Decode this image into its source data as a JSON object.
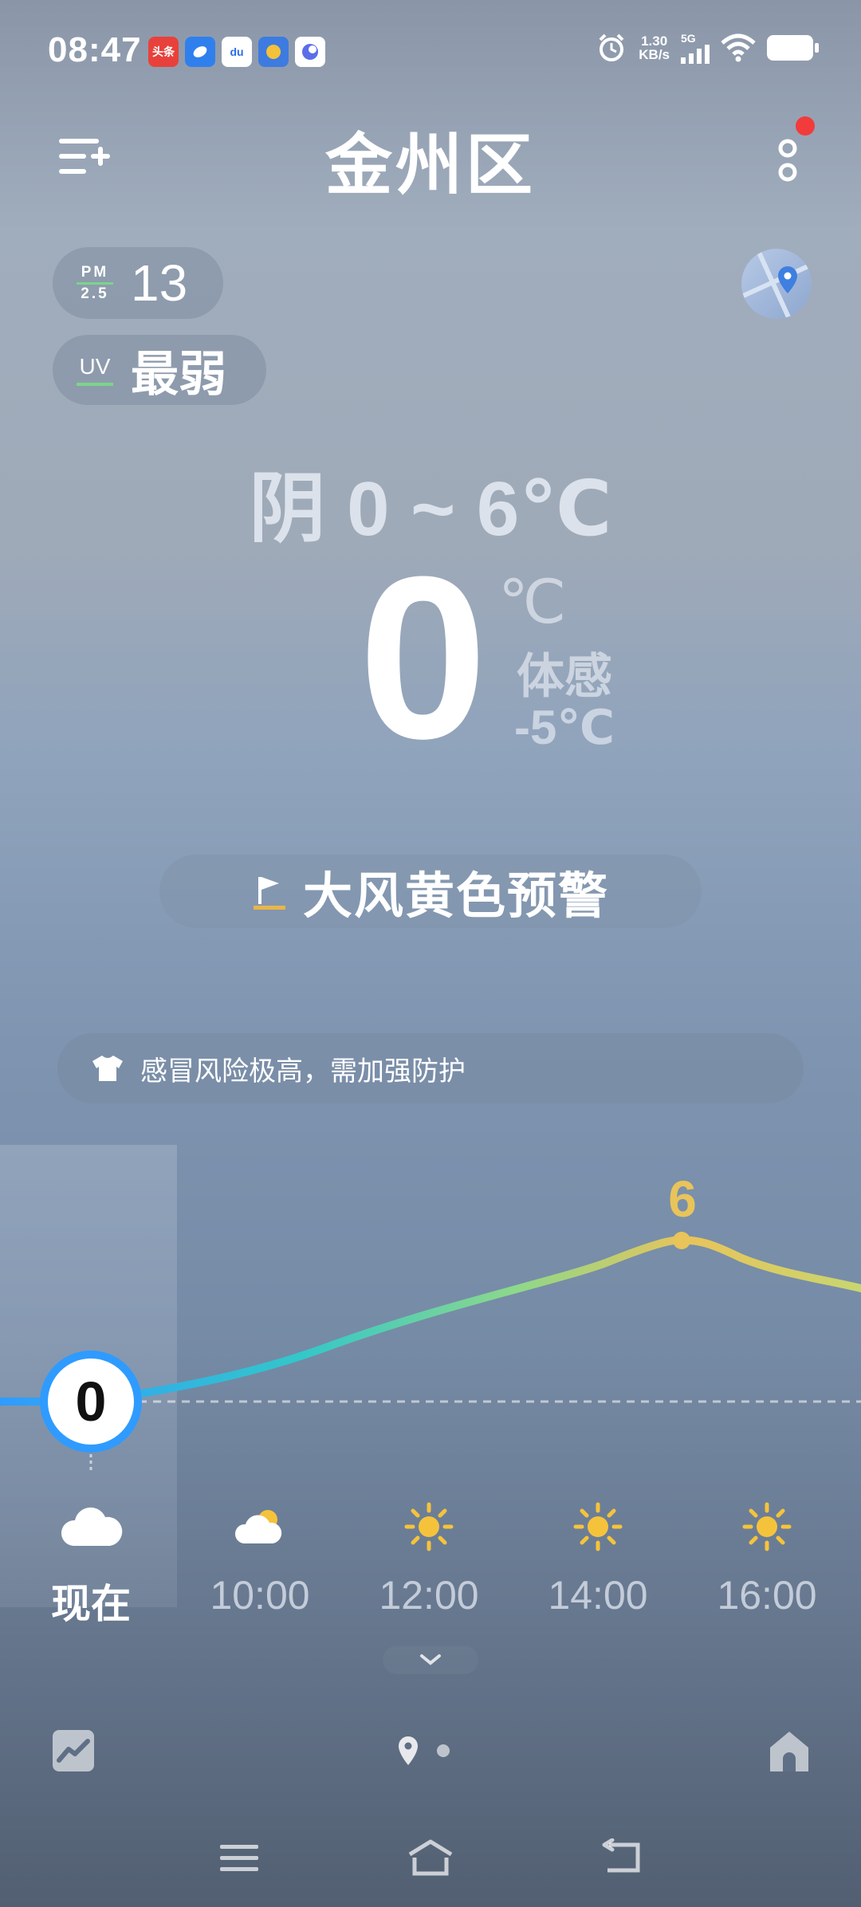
{
  "status_bar": {
    "time": "08:47",
    "notifications": [
      {
        "name": "toutiao-notification-icon",
        "text": "头条",
        "color": "#e8413b"
      },
      {
        "name": "chat-notification-icon",
        "text": "",
        "color": "#2f80ed"
      },
      {
        "name": "baidu-notification-icon",
        "text": "du",
        "color": "#2b6de8"
      },
      {
        "name": "app-notification-icon",
        "text": "",
        "color": "#3d7be0"
      },
      {
        "name": "browser-notification-icon",
        "text": "",
        "color": "#5b6ee8"
      }
    ],
    "net_speed_value": "1.30",
    "net_speed_unit": "KB/s",
    "network_type": "5G"
  },
  "header": {
    "city": "金州区"
  },
  "air": {
    "pm_label_top": "PM",
    "pm_label_bottom": "2.5",
    "pm_value": "13",
    "uv_label": "UV",
    "uv_value": "最弱"
  },
  "current": {
    "range_text": "阴 0 ~ 6℃",
    "temperature": "0",
    "unit": "℃",
    "feels_label": "体感",
    "feels_value": "-5℃"
  },
  "alert": {
    "text": "大风黄色预警",
    "color": "#e8b54a"
  },
  "advice": {
    "text": "感冒风险极高，需加强防护"
  },
  "hourly": {
    "current_temp": "0",
    "peak_temp": "6",
    "hours": [
      {
        "label": "现在",
        "icon": "cloudy-icon"
      },
      {
        "label": "10:00",
        "icon": "partly-cloudy-icon"
      },
      {
        "label": "12:00",
        "icon": "sunny-icon"
      },
      {
        "label": "14:00",
        "icon": "sunny-icon"
      },
      {
        "label": "16:00",
        "icon": "sunny-icon"
      }
    ],
    "curve_colors": [
      "#2f9bff",
      "#33c7c9",
      "#8ed88a",
      "#e8c45a"
    ]
  }
}
